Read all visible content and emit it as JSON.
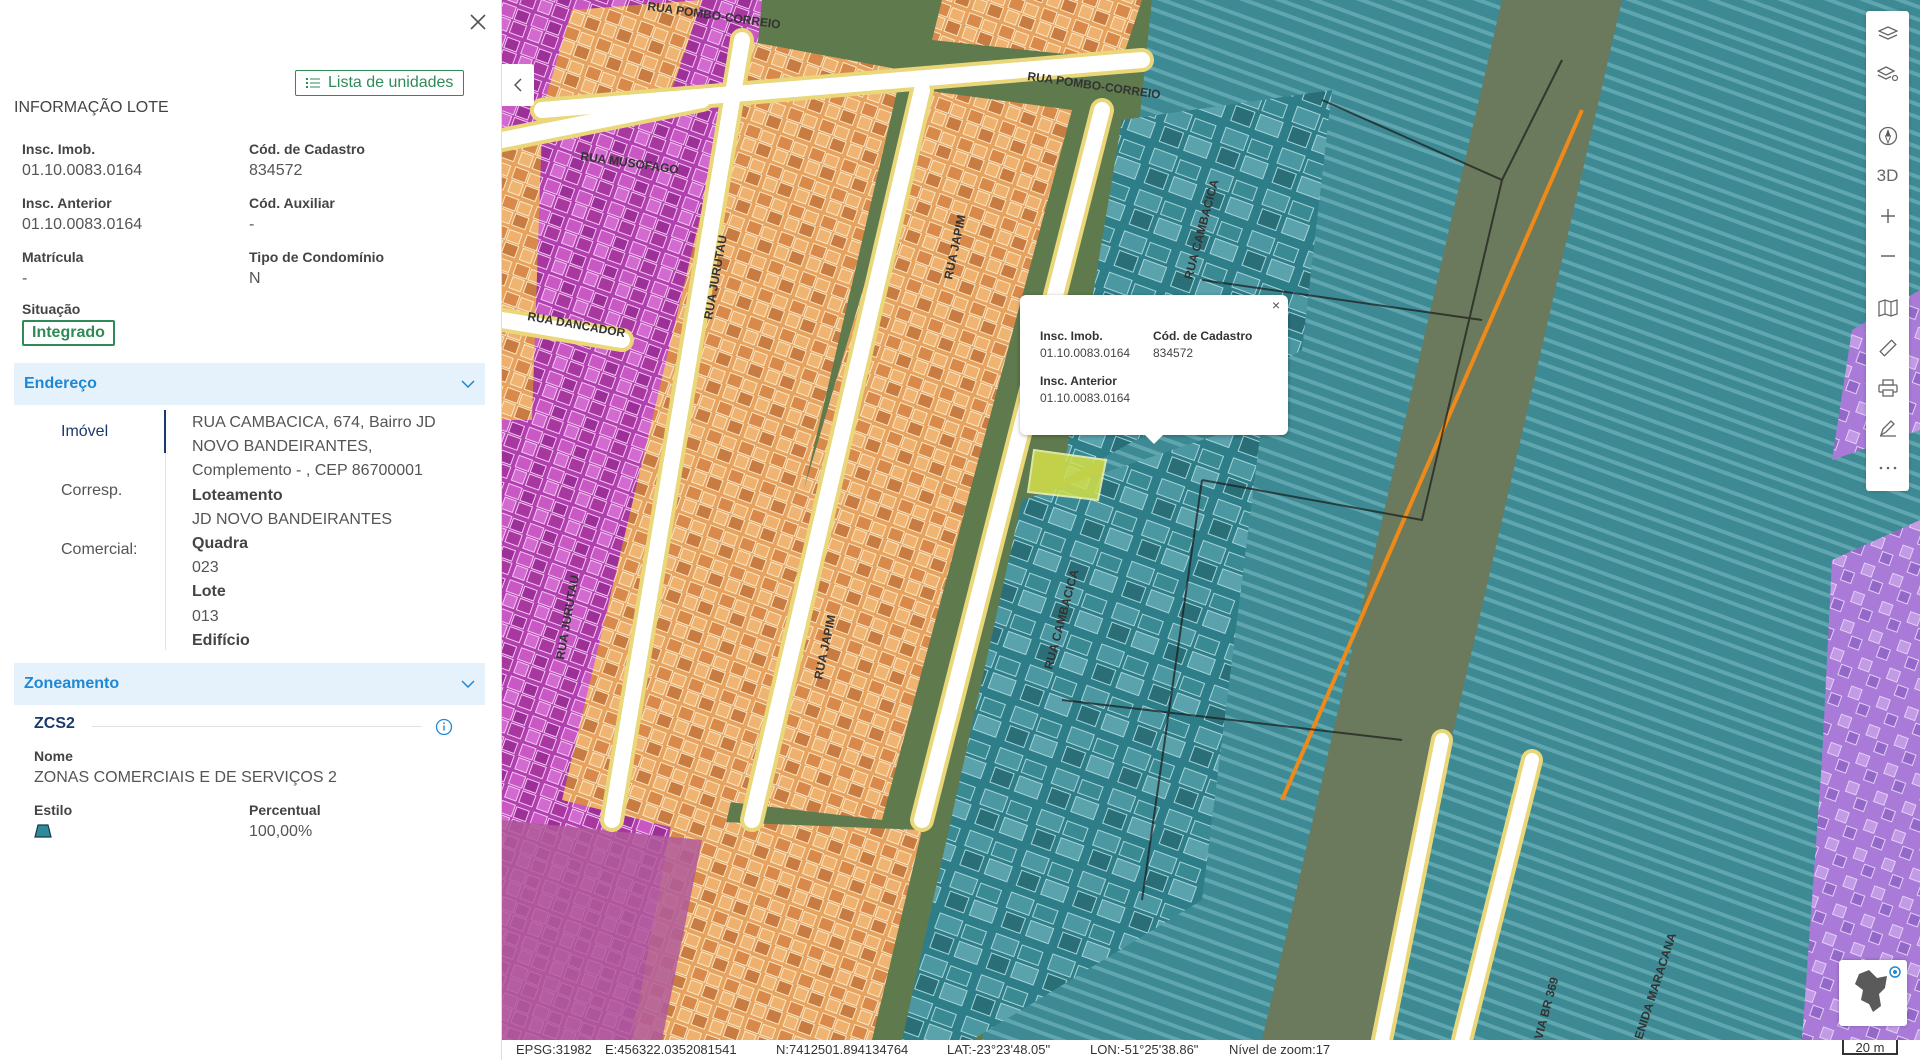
{
  "panel": {
    "title": "INFORMAÇÃO LOTE",
    "list_button": "Lista de unidades",
    "fields": {
      "insc_imob_label": "Insc. Imob.",
      "insc_imob_value": "01.10.0083.0164",
      "cod_cadastro_label": "Cód. de Cadastro",
      "cod_cadastro_value": "834572",
      "insc_anterior_label": "Insc. Anterior",
      "insc_anterior_value": "01.10.0083.0164",
      "cod_auxiliar_label": "Cód. Auxiliar",
      "cod_auxiliar_value": "-",
      "matricula_label": "Matrícula",
      "matricula_value": "-",
      "tipo_condominio_label": "Tipo de Condomínio",
      "tipo_condominio_value": "N",
      "situacao_label": "Situação",
      "situacao_value": "Integrado"
    },
    "endereco": {
      "header": "Endereço",
      "tabs": [
        "Imóvel",
        "Corresp.",
        "Comercial:"
      ],
      "address_lines": [
        "RUA CAMBACICA, 674, Bairro JD",
        "NOVO BANDEIRANTES,",
        "Complemento - , CEP 86700001"
      ],
      "loteamento_label": "Loteamento",
      "loteamento_value": "JD NOVO BANDEIRANTES",
      "quadra_label": "Quadra",
      "quadra_value": "023",
      "lote_label": "Lote",
      "lote_value": "013",
      "edificio_label": "Edifício"
    },
    "zoneamento": {
      "header": "Zoneamento",
      "code": "ZCS2",
      "nome_label": "Nome",
      "nome_value": "ZONAS COMERCIAIS E DE SERVIÇOS 2",
      "estilo_label": "Estilo",
      "percentual_label": "Percentual",
      "percentual_value": "100,00%"
    }
  },
  "map": {
    "toolbar": {
      "three_d_label": "3D"
    },
    "popup": {
      "insc_imob_label": "Insc. Imob.",
      "insc_imob_value": "01.10.0083.0164",
      "cod_cadastro_label": "Cód. de Cadastro",
      "cod_cadastro_value": "834572",
      "insc_anterior_label": "Insc. Anterior",
      "insc_anterior_value": "01.10.0083.0164",
      "close": "×"
    },
    "road_labels": [
      "RUA POMBO-CORREIO",
      "RUA POMBO-CORREIO",
      "RUA MUSOFAGO",
      "RUA JURUTAU",
      "RUA JAPIM",
      "RUA CAMBACICA",
      "RUA DANCADOR",
      "RUA JURUTAU",
      "RUA JAPIM",
      "RUA CAMBACICA",
      "VIA BR 369",
      "ENIDA MARACANA"
    ],
    "colors": {
      "residential": "#e8a15a",
      "commercial": "#b23fb0",
      "industrial": "#2e8a9a",
      "roads": "#f0e39a",
      "selected": "#d4e04a"
    }
  },
  "statusbar": {
    "epsg": "EPSG:31982",
    "easting": "E:456322.0352081541",
    "northing": "N:7412501.894134764",
    "lat": "LAT:-23°23'48.05\"",
    "lon": "LON:-51°25'38.86\"",
    "zoom": "Nível de zoom:17",
    "scale": "20 m"
  }
}
